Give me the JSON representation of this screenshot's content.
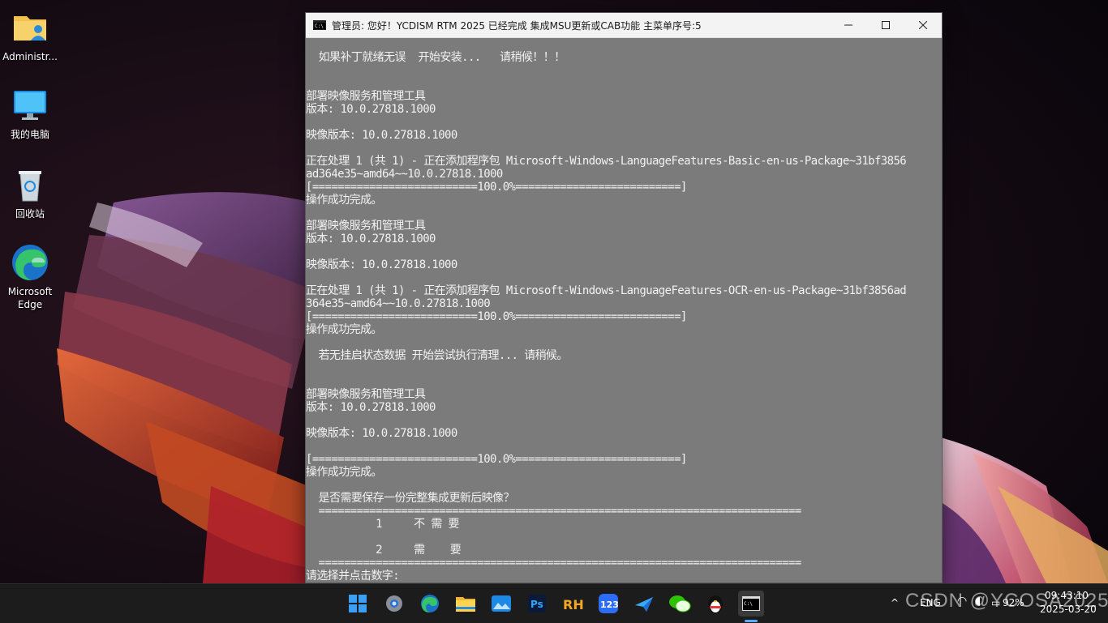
{
  "desktop": {
    "icons": [
      {
        "label": "Administr..."
      },
      {
        "label": "我的电脑"
      },
      {
        "label": "回收站"
      },
      {
        "label_line1": "Microsoft",
        "label_line2": "Edge"
      }
    ]
  },
  "console": {
    "title": "管理员:   您好！YCDISM RTM 2025 已经完成 集成MSU更新或CAB功能  主菜单序号:5",
    "lines": [
      "",
      "  如果补丁就绪无误  开始安装...   请稍候！！！",
      "",
      "",
      "部署映像服务和管理工具",
      "版本: 10.0.27818.1000",
      "",
      "映像版本: 10.0.27818.1000",
      "",
      "正在处理 1 (共 1) - 正在添加程序包 Microsoft-Windows-LanguageFeatures-Basic-en-us-Package~31bf3856",
      "ad364e35~amd64~~10.0.27818.1000",
      "[==========================100.0%==========================]",
      "操作成功完成。",
      "",
      "部署映像服务和管理工具",
      "版本: 10.0.27818.1000",
      "",
      "映像版本: 10.0.27818.1000",
      "",
      "正在处理 1 (共 1) - 正在添加程序包 Microsoft-Windows-LanguageFeatures-OCR-en-us-Package~31bf3856ad",
      "364e35~amd64~~10.0.27818.1000",
      "[==========================100.0%==========================]",
      "操作成功完成。",
      "",
      "  若无挂启状态数据 开始尝试执行清理... 请稍候。",
      "",
      "",
      "部署映像服务和管理工具",
      "版本: 10.0.27818.1000",
      "",
      "映像版本: 10.0.27818.1000",
      "",
      "[==========================100.0%==========================]",
      "操作成功完成。",
      "",
      "  是否需要保存一份完整集成更新后映像？",
      "  ============================================================================",
      "           1     不 需 要",
      "",
      "           2     需    要",
      "  ============================================================================",
      "请选择并点击数字:"
    ]
  },
  "taskbar": {
    "apps": [
      {
        "name": "start"
      },
      {
        "name": "settings"
      },
      {
        "name": "edge"
      },
      {
        "name": "file-explorer"
      },
      {
        "name": "photos"
      },
      {
        "name": "photoshop",
        "label": "Ps"
      },
      {
        "name": "rh",
        "label": "RH"
      },
      {
        "name": "123pan",
        "label": "123"
      },
      {
        "name": "feishu"
      },
      {
        "name": "wechat"
      },
      {
        "name": "qq"
      },
      {
        "name": "console"
      }
    ],
    "tray": {
      "lang": "ENG",
      "battery": "92%",
      "time": "09:43:10",
      "date": "2025-03-20"
    }
  },
  "watermark": "CSDN @YCOSA2025",
  "colors": {
    "console_bg": "#7b7b7b",
    "console_text": "#f2f2f2",
    "titlebar": "#f3f3f3",
    "taskbar": "#1c1c1c",
    "accent": "#5aa7ff"
  }
}
